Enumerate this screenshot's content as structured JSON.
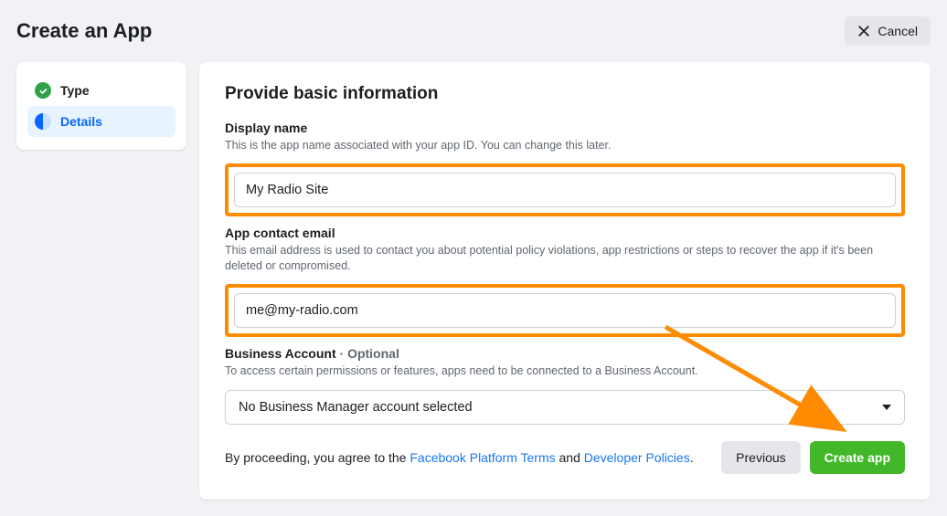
{
  "header": {
    "title": "Create an App",
    "cancel_label": "Cancel"
  },
  "sidebar": {
    "steps": [
      {
        "label": "Type",
        "status": "complete"
      },
      {
        "label": "Details",
        "status": "active"
      }
    ]
  },
  "main": {
    "title": "Provide basic information",
    "display_name": {
      "label": "Display name",
      "desc": "This is the app name associated with your app ID. You can change this later.",
      "value": "My Radio Site"
    },
    "contact_email": {
      "label": "App contact email",
      "desc": "This email address is used to contact you about potential policy violations, app restrictions or steps to recover the app if it's been deleted or compromised.",
      "value": "me@my-radio.com"
    },
    "business_account": {
      "label": "Business Account",
      "optional_text": " · Optional",
      "desc": "To access certain permissions or features, apps need to be connected to a Business Account.",
      "selected": "No Business Manager account selected"
    },
    "terms": {
      "prefix": "By proceeding, you agree to the ",
      "link1": "Facebook Platform Terms",
      "mid": " and ",
      "link2": "Developer Policies",
      "suffix": "."
    },
    "buttons": {
      "previous": "Previous",
      "create": "Create app"
    }
  }
}
